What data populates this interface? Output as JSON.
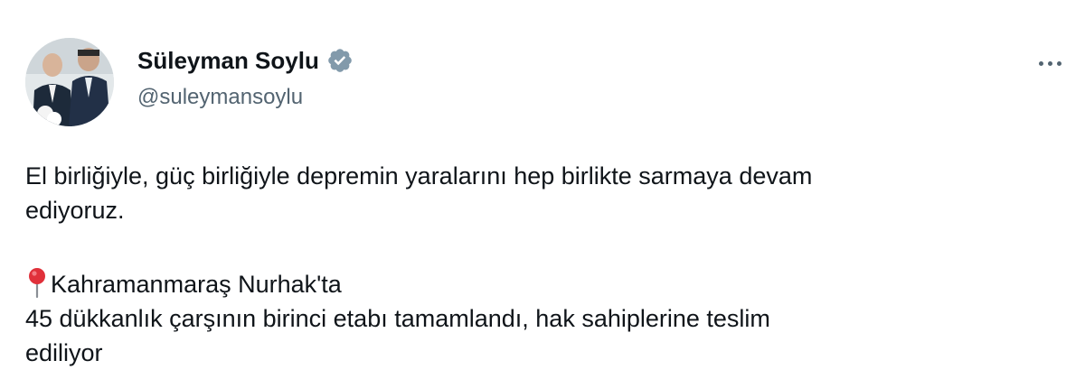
{
  "author": {
    "name": "Süleyman Soylu",
    "handle": "@suleymansoylu",
    "verified_color": "#829aab",
    "avatar_icon": "profile-photo"
  },
  "menu": {
    "icon": "more-horizontal-icon"
  },
  "tweet": {
    "line1": "El birliğiyle, güç birliğiyle depremin yaralarını hep birlikte sarmaya devam",
    "line2": "ediyoruz.",
    "location_icon": "round-pushpin-emoji",
    "line3": "Kahramanmaraş Nurhak'ta",
    "line4": "45 dükkanlık çarşının birinci etabı tamamlandı, hak sahiplerine teslim",
    "line5": "ediliyor"
  }
}
